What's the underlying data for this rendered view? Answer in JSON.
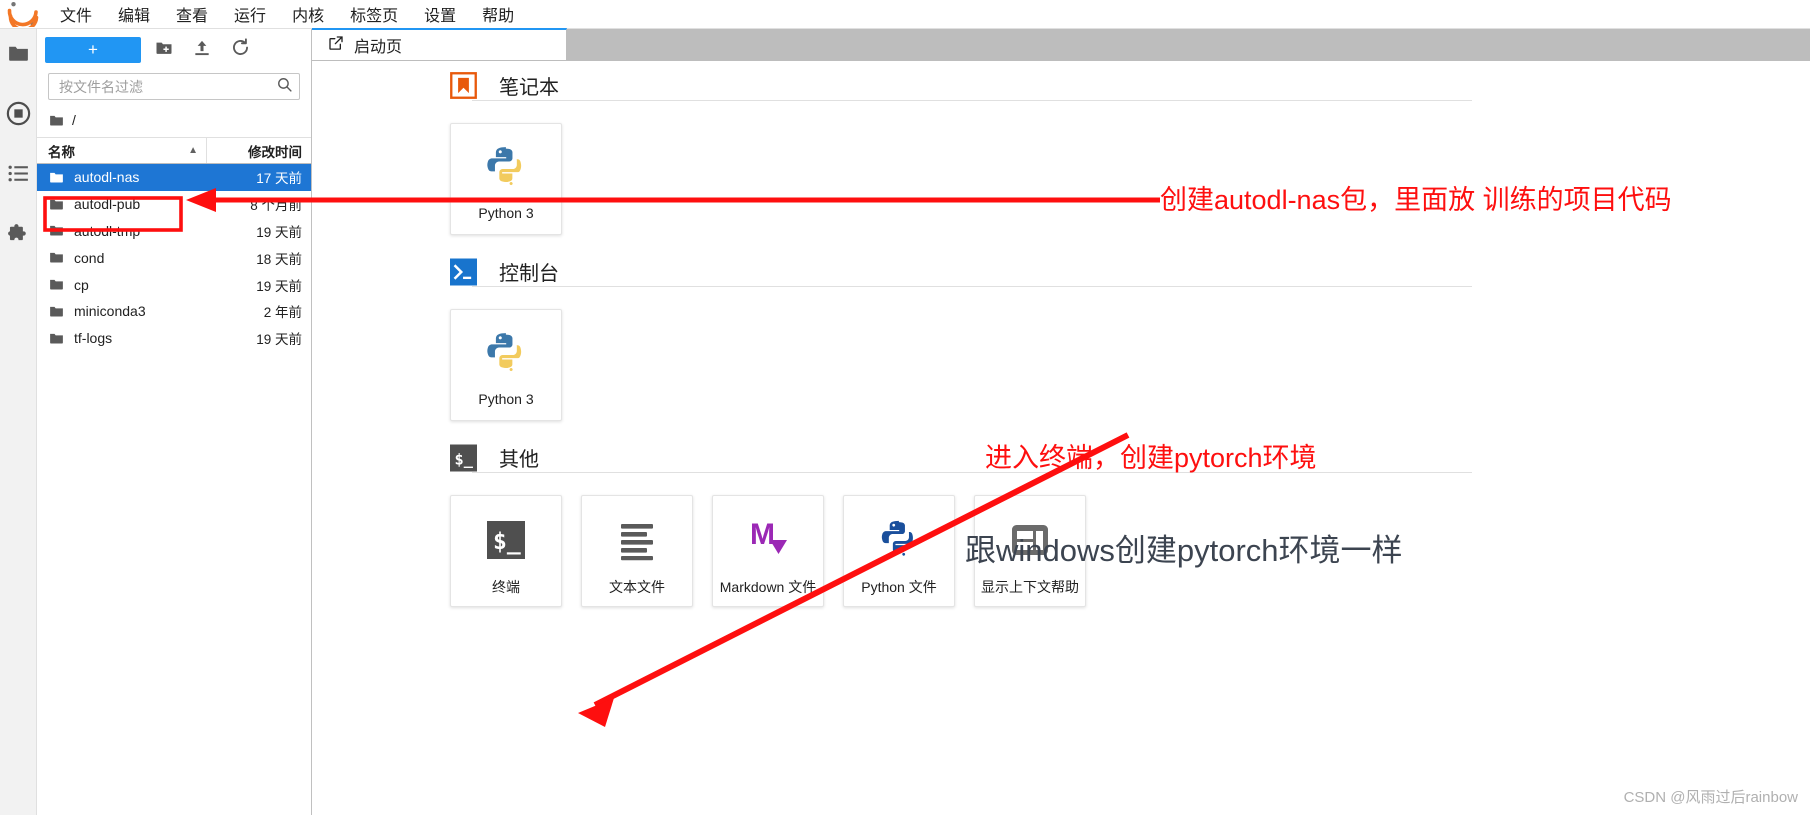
{
  "app": {
    "logo_icon": "jupyter-logo-icon",
    "menus": [
      {
        "label": "文件",
        "name": "menu-file"
      },
      {
        "label": "编辑",
        "name": "menu-edit"
      },
      {
        "label": "查看",
        "name": "menu-view"
      },
      {
        "label": "运行",
        "name": "menu-run"
      },
      {
        "label": "内核",
        "name": "menu-kernel"
      },
      {
        "label": "标签页",
        "name": "menu-tabs"
      },
      {
        "label": "设置",
        "name": "menu-settings"
      },
      {
        "label": "帮助",
        "name": "menu-help"
      }
    ]
  },
  "activitybar": {
    "items": [
      {
        "name": "sidebar-item-file-browser",
        "icon": "folder-icon",
        "active": true
      },
      {
        "name": "sidebar-item-running",
        "icon": "stop-square-icon",
        "active": false
      },
      {
        "name": "sidebar-item-commands",
        "icon": "list-icon",
        "active": false
      },
      {
        "name": "sidebar-item-extensions",
        "icon": "puzzle-icon",
        "active": false
      }
    ]
  },
  "filebrowser": {
    "new_launcher_label": "+",
    "toolbar_icons": [
      {
        "name": "new-folder-button",
        "icon": "new-folder-icon"
      },
      {
        "name": "upload-button",
        "icon": "upload-icon"
      },
      {
        "name": "refresh-button",
        "icon": "refresh-icon"
      }
    ],
    "filter_placeholder": "按文件名过滤",
    "filter_value": "",
    "search_icon": "search-icon",
    "breadcrumb_root": "/",
    "columns": {
      "name": "名称",
      "modified": "修改时间"
    },
    "sort_indicator": "▲",
    "rows": [
      {
        "name": "autodl-nas",
        "modified": "17 天前",
        "selected": true
      },
      {
        "name": "autodl-pub",
        "modified": "8 个月前",
        "selected": false
      },
      {
        "name": "autodl-tmp",
        "modified": "19 天前",
        "selected": false
      },
      {
        "name": "cond",
        "modified": "18 天前",
        "selected": false
      },
      {
        "name": "cp",
        "modified": "19 天前",
        "selected": false
      },
      {
        "name": "miniconda3",
        "modified": "2 年前",
        "selected": false
      },
      {
        "name": "tf-logs",
        "modified": "19 天前",
        "selected": false
      }
    ]
  },
  "dock": {
    "tabs": [
      {
        "label": "启动页",
        "icon": "launcher-icon",
        "active": true
      }
    ]
  },
  "launcher": {
    "sections": [
      {
        "title": "笔记本",
        "icon": "notebook-bookmark-icon",
        "cards": [
          {
            "label": "Python 3",
            "icon": "python-logo-icon"
          }
        ]
      },
      {
        "title": "控制台",
        "icon": "console-prompt-icon",
        "cards": [
          {
            "label": "Python 3",
            "icon": "python-logo-icon"
          }
        ]
      },
      {
        "title": "其他",
        "icon": "terminal-dollar-icon",
        "cards": [
          {
            "label": "终端",
            "icon": "terminal-dollar-icon"
          },
          {
            "label": "文本文件",
            "icon": "text-file-icon"
          },
          {
            "label": "Markdown 文件",
            "icon": "markdown-icon"
          },
          {
            "label": "Python 文件",
            "icon": "python-logo-icon"
          },
          {
            "label": "显示上下文帮助",
            "icon": "context-help-icon"
          }
        ]
      }
    ]
  },
  "annotations": {
    "color": "#fe0f0f",
    "items": [
      {
        "text": "创建autodl-nas包，里面放 训练的项目代码",
        "name": "annotation-create-nas"
      },
      {
        "text": "进入终端，创建pytorch环境",
        "name": "annotation-enter-terminal"
      }
    ],
    "note": {
      "text": "跟windows创建pytorch环境一样",
      "name": "annotation-note-windows"
    }
  },
  "watermark": {
    "text": "CSDN @风雨过后rainbow"
  }
}
